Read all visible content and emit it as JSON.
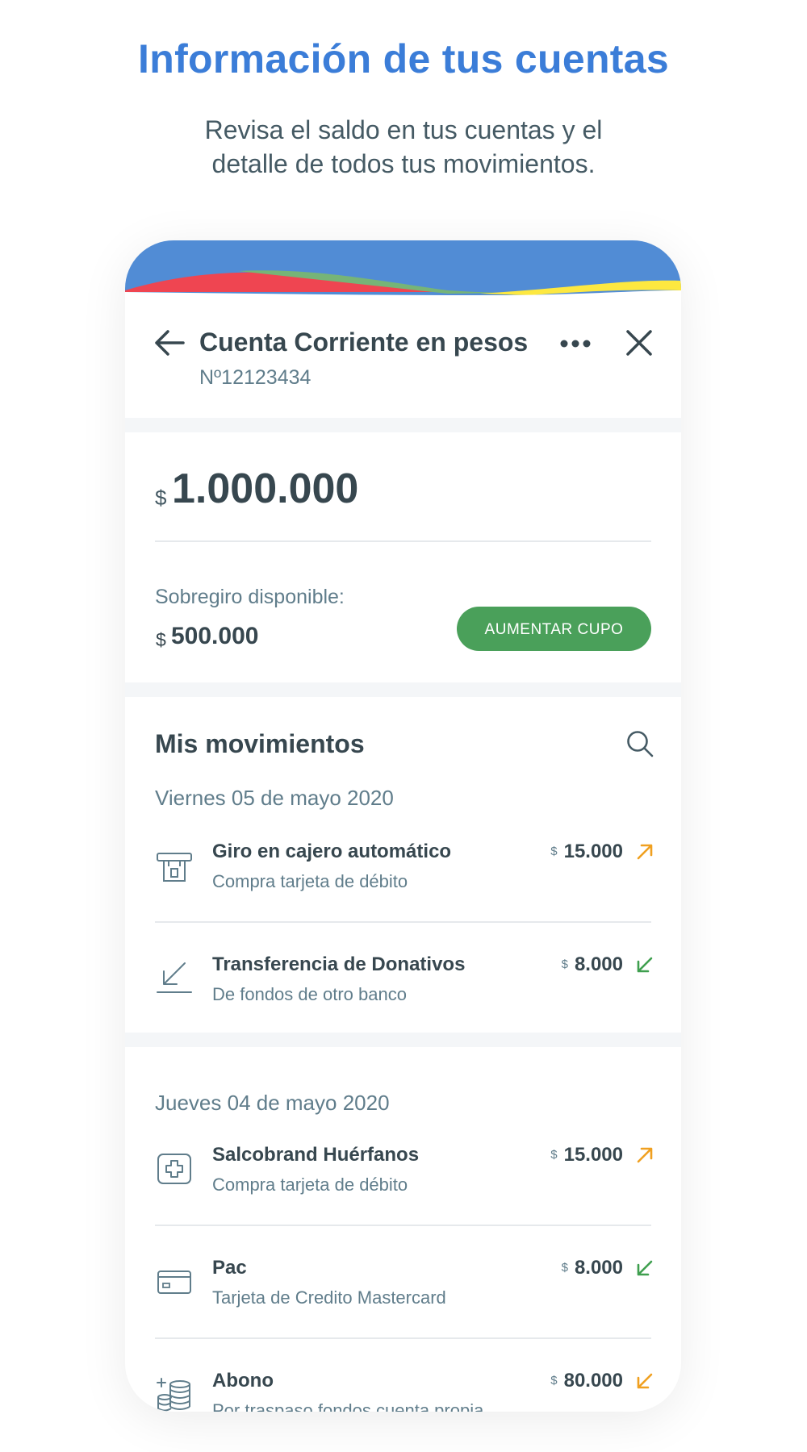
{
  "promo": {
    "title": "Información de tus cuentas",
    "subtitle_line1": "Revisa el saldo en tus cuentas y el",
    "subtitle_line2": "detalle de todos tus movimientos."
  },
  "colors": {
    "title_blue": "#3b7dd8",
    "wave_blue": "#518cd5",
    "wave_red": "#ef4551",
    "wave_green": "#76b477",
    "wave_yellow": "#fde840",
    "button_green": "#4aa05a",
    "out_arrow": "#f0a020",
    "in_arrow": "#3f9f4f"
  },
  "account": {
    "title": "Cuenta Corriente en pesos",
    "number": "Nº12123434",
    "icons": {
      "back": "arrow-left-icon",
      "more": "more-dots-icon",
      "close": "close-icon"
    }
  },
  "balance": {
    "currency": "$",
    "amount": "1.000.000",
    "overdraft_label": "Sobregiro disponible:",
    "overdraft_currency": "$",
    "overdraft_amount": "500.000",
    "button_label": "AUMENTAR CUPO"
  },
  "movements": {
    "title": "Mis movimientos",
    "search_icon": "search-icon",
    "groups": [
      {
        "date": "Viernes 05 de mayo 2020",
        "items": [
          {
            "icon": "atm-icon",
            "title": "Giro en cajero automático",
            "subtitle": "Compra tarjeta de débito",
            "currency": "$",
            "amount": "15.000",
            "direction": "out",
            "arrow_icon": "arrow-up-right-icon"
          },
          {
            "icon": "transfer-in-icon",
            "title": "Transferencia de Donativos",
            "subtitle": "De fondos de otro banco",
            "currency": "$",
            "amount": "8.000",
            "direction": "in",
            "arrow_icon": "arrow-down-left-icon"
          }
        ]
      },
      {
        "date": "Jueves 04 de mayo 2020",
        "items": [
          {
            "icon": "pharmacy-icon",
            "title": "Salcobrand Huérfanos",
            "subtitle": "Compra tarjeta de débito",
            "currency": "$",
            "amount": "15.000",
            "direction": "out",
            "arrow_icon": "arrow-up-right-icon"
          },
          {
            "icon": "credit-card-icon",
            "title": "Pac",
            "subtitle": "Tarjeta de Credito Mastercard",
            "currency": "$",
            "amount": "8.000",
            "direction": "in",
            "arrow_icon": "arrow-down-left-icon"
          },
          {
            "icon": "coins-icon",
            "title": "Abono",
            "subtitle": "Por traspaso fondos cuenta propia",
            "currency": "$",
            "amount": "80.000",
            "direction": "in-orange",
            "arrow_icon": "arrow-down-left-icon"
          }
        ]
      }
    ]
  }
}
